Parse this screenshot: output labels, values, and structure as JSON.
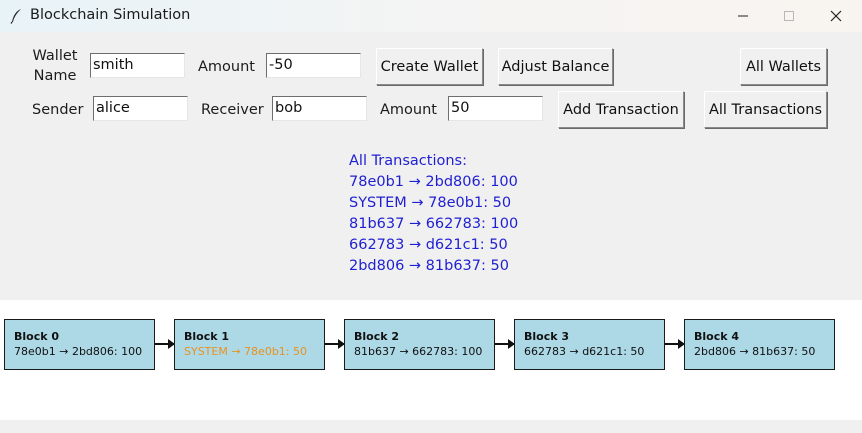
{
  "window": {
    "title": "Blockchain Simulation",
    "icons": {
      "app": "feather-icon",
      "minimize": "minimize-icon",
      "maximize": "maximize-icon",
      "close": "close-icon"
    }
  },
  "wallet_row": {
    "name_label": "Wallet\nName",
    "name_value": "smith",
    "amount_label": "Amount",
    "amount_value": "-50",
    "create_button": "Create Wallet",
    "adjust_button": "Adjust Balance",
    "all_wallets_button": "All Wallets"
  },
  "transaction_row": {
    "sender_label": "Sender",
    "sender_value": "alice",
    "receiver_label": "Receiver",
    "receiver_value": "bob",
    "amount_label": "Amount",
    "amount_value": "50",
    "add_button": "Add Transaction",
    "all_transactions_button": "All Transactions"
  },
  "output": {
    "heading": "All Transactions:",
    "lines": [
      "78e0b1 → 2bd806: 100",
      "SYSTEM → 78e0b1: 50",
      "81b637 → 662783: 100",
      "662783 → d621c1: 50",
      "2bd806 → 81b637: 50"
    ],
    "color": "#1f1fd2"
  },
  "blocks": [
    {
      "title": "Block 0",
      "tx": "78e0b1 → 2bd806: 100",
      "reward": false
    },
    {
      "title": "Block 1",
      "tx": "SYSTEM → 78e0b1: 50",
      "reward": true
    },
    {
      "title": "Block 2",
      "tx": "81b637 → 662783: 100",
      "reward": false
    },
    {
      "title": "Block 3",
      "tx": "662783 → d621c1: 50",
      "reward": false
    },
    {
      "title": "Block 4",
      "tx": "2bd806 → 81b637: 50",
      "reward": false
    }
  ],
  "colors": {
    "block_fill": "#add8e6",
    "reward_text": "#e69322"
  }
}
